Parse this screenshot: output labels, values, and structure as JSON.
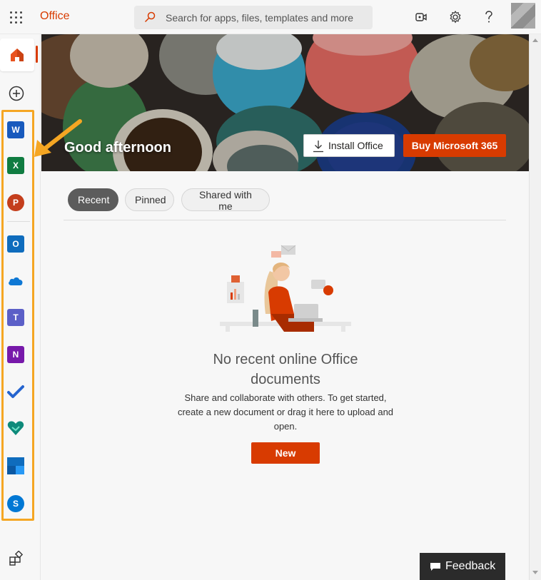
{
  "app": {
    "brand": "Office",
    "search_placeholder": "Search for apps, files, templates and more"
  },
  "topbar_icons": [
    "waffle-icon",
    "teams-meet-icon",
    "gear-icon",
    "help-icon",
    "avatar"
  ],
  "hero": {
    "greeting": "Good afternoon",
    "install_label": "Install Office",
    "buy_label": "Buy Microsoft 365"
  },
  "rail": {
    "apps": [
      {
        "name": "Word",
        "letter": "W",
        "color": "#185abd"
      },
      {
        "name": "Excel",
        "letter": "X",
        "color": "#107c41"
      },
      {
        "name": "PowerPoint",
        "letter": "P",
        "color": "#c43e1c"
      },
      {
        "name": "Outlook",
        "letter": "O",
        "color": "#0f6cbd"
      },
      {
        "name": "OneDrive",
        "letter": "",
        "color": "#0f78d4"
      },
      {
        "name": "Teams",
        "letter": "T",
        "color": "#5b5fc7"
      },
      {
        "name": "OneNote",
        "letter": "N",
        "color": "#7719aa"
      },
      {
        "name": "To Do",
        "letter": "",
        "color": "#2564cf"
      },
      {
        "name": "Family Safety",
        "letter": "",
        "color": "#0e8a7a"
      },
      {
        "name": "Calendar",
        "letter": "",
        "color": "#0f6cbd"
      },
      {
        "name": "Skype",
        "letter": "S",
        "color": "#0078d4"
      }
    ],
    "highlight_color": "#f5a623"
  },
  "tabs": [
    {
      "label": "Recent",
      "active": true
    },
    {
      "label": "Pinned",
      "active": false
    },
    {
      "label": "Shared with me",
      "active": false
    }
  ],
  "empty_state": {
    "title": "No recent online Office documents",
    "description": "Share and collaborate with others. To get started, create a new document or drag it here to upload and open.",
    "new_label": "New"
  },
  "feedback": {
    "label": "Feedback"
  },
  "colors": {
    "accent": "#d83b01",
    "annotation": "#f5a623"
  }
}
